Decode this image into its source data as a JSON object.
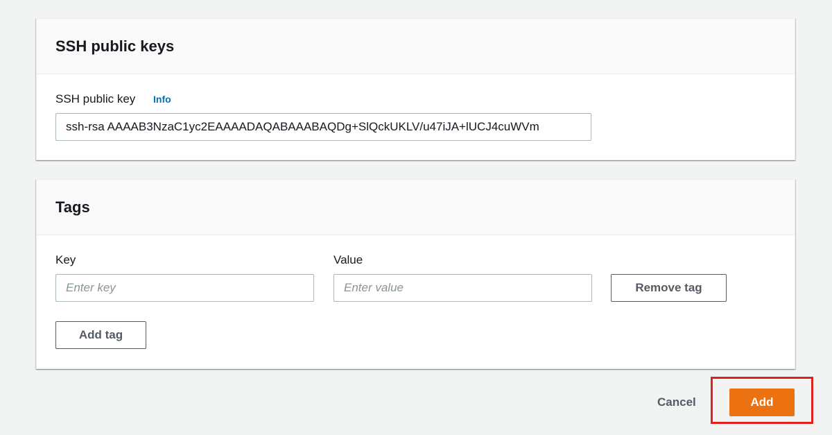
{
  "ssh_panel": {
    "title": "SSH public keys",
    "field_label": "SSH public key",
    "info_label": "Info",
    "key_value": "ssh-rsa AAAAB3NzaC1yc2EAAAADAQABAAABAQDg+SlQckUKLV/u47iJA+lUCJ4cuWVm"
  },
  "tags_panel": {
    "title": "Tags",
    "key_label": "Key",
    "value_label": "Value",
    "key_placeholder": "Enter key",
    "value_placeholder": "Enter value",
    "key_value": "",
    "value_value": "",
    "remove_tag_label": "Remove tag",
    "add_tag_label": "Add tag"
  },
  "footer": {
    "cancel_label": "Cancel",
    "add_label": "Add"
  },
  "colors": {
    "primary": "#ec7211",
    "link": "#0073bb",
    "highlight": "#e0221c",
    "background": "#f2f3f3"
  }
}
